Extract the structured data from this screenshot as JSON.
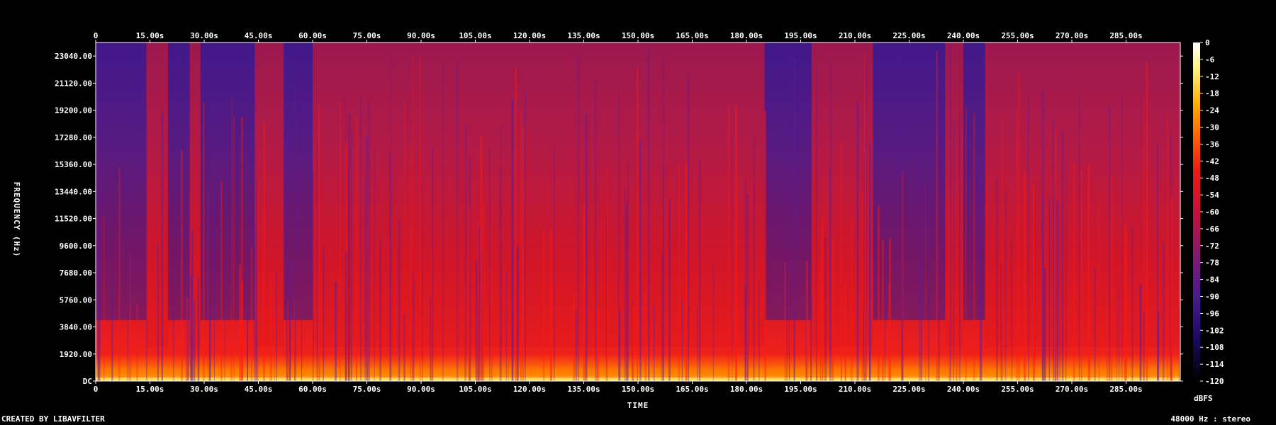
{
  "chart_data": {
    "type": "heatmap",
    "xlabel": "TIME",
    "ylabel": "FREQUENCY (Hz)",
    "colorbar_label": "dBFS",
    "x_ticks": [
      "0",
      "15.00s",
      "30.00s",
      "45.00s",
      "60.00s",
      "75.00s",
      "90.00s",
      "105.00s",
      "120.00s",
      "135.00s",
      "150.00s",
      "165.00s",
      "180.00s",
      "195.00s",
      "210.00s",
      "225.00s",
      "240.00s",
      "255.00s",
      "270.00s",
      "285.00s"
    ],
    "y_ticks": [
      "DC",
      "1920.00",
      "3840.00",
      "5760.00",
      "7680.00",
      "9600.00",
      "11520.00",
      "13440.00",
      "15360.00",
      "17280.00",
      "19200.00",
      "21120.00",
      "23040.00"
    ],
    "colorbar_ticks": [
      "0",
      "-6",
      "-12",
      "-18",
      "-24",
      "-30",
      "-36",
      "-42",
      "-48",
      "-54",
      "-60",
      "-66",
      "-72",
      "-78",
      "-84",
      "-90",
      "-96",
      "-102",
      "-108",
      "-114",
      "-120"
    ],
    "xlim": [
      0,
      300
    ],
    "ylim": [
      0,
      24000
    ],
    "colorbar_range": [
      -120,
      0
    ],
    "colormap": [
      "#000000",
      "#1a0a5e",
      "#4a1a8c",
      "#7a1a7a",
      "#b8103a",
      "#e8101a",
      "#ff5a00",
      "#ffb000",
      "#fff07a",
      "#ffffff"
    ],
    "loud_time_bands": [
      [
        14,
        20
      ],
      [
        26,
        29
      ],
      [
        44,
        52
      ],
      [
        60,
        130
      ],
      [
        130,
        185
      ],
      [
        198,
        215
      ],
      [
        235,
        240
      ],
      [
        246,
        300
      ]
    ]
  },
  "footer": {
    "left": "CREATED BY LIBAVFILTER",
    "right": "48000 Hz : stereo"
  }
}
